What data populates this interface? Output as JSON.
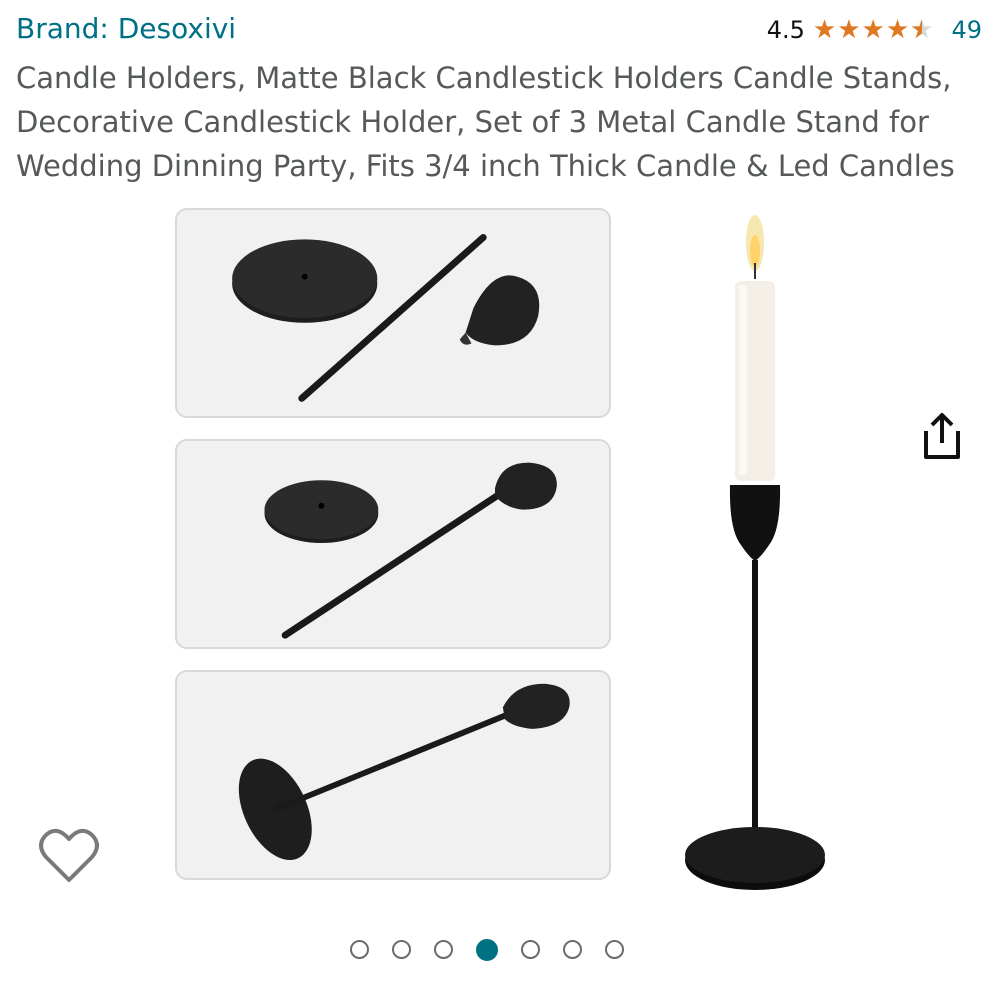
{
  "brand": {
    "label": "Brand: Desoxivi"
  },
  "rating": {
    "value": "4.5",
    "stars": 4.5,
    "count": "49"
  },
  "product": {
    "title": "Candle Holders, Matte Black Candlestick Holders Candle Stands, Decorative Candlestick Holder, Set of 3 Metal Candle Stand for Wedding Dinning Party, Fits 3/4 inch Thick Candle & Led Candles"
  },
  "gallery": {
    "image_count": 7,
    "active_index": 3
  },
  "colors": {
    "link": "#007185",
    "star": "#de7921",
    "text": "#565959"
  },
  "icons": {
    "share": "share-icon",
    "wishlist": "heart-icon"
  }
}
